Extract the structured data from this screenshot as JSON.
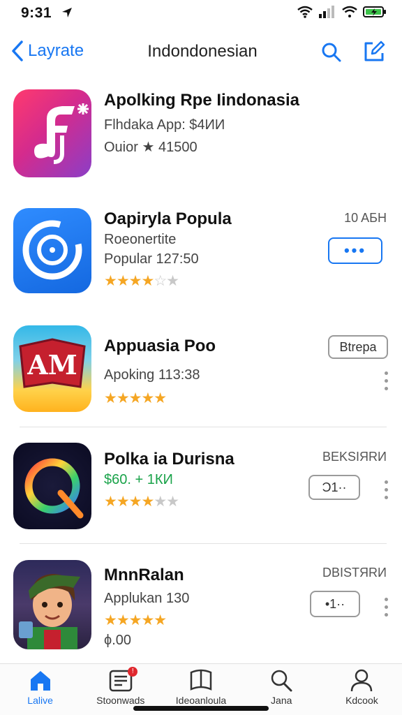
{
  "status": {
    "time": "9:31"
  },
  "nav": {
    "back_label": "Layrate",
    "title": "Indondonesian"
  },
  "apps": [
    {
      "title": "Apolking Rpe Iindonasia",
      "subtitle": "Flhdaka App: $4ИИ",
      "line3": "Ouior ★ 41500"
    },
    {
      "title": "Oapiryla Popula",
      "subtitle": "Roeonertite",
      "line3": "Popular 127:50",
      "meta": "10 AБH",
      "button_label": "•••",
      "rating": 3.5
    },
    {
      "title": "Appuasia Poo",
      "subtitle": "Apoking 113:38",
      "button_label": "Btrepa",
      "rating": 4.5,
      "icon_text": "AM"
    },
    {
      "title": "Polka ia Durisna",
      "price": "$60. + 1КИ",
      "meta": "BEKSIЯRИ",
      "button_label": "Ɔ1··",
      "rating": 3.5
    },
    {
      "title": "MnnRalan",
      "subtitle": "Applukan 130",
      "meta": "DBISTЯRИ",
      "button_label": "•1··",
      "rating": 4.5,
      "line4": "ϕ.00"
    }
  ],
  "tabs": [
    {
      "label": "Lalive",
      "icon": "home-icon",
      "active": true
    },
    {
      "label": "Stoonwads",
      "icon": "news-icon",
      "badge": "!"
    },
    {
      "label": "Ideoanloula",
      "icon": "library-icon"
    },
    {
      "label": "Jana",
      "icon": "search-icon"
    },
    {
      "label": "Kdcook",
      "icon": "person-icon"
    }
  ],
  "colors": {
    "accent": "#1877f2",
    "star": "#f5a623",
    "price": "#1aa34a",
    "badge": "#e0282e"
  }
}
